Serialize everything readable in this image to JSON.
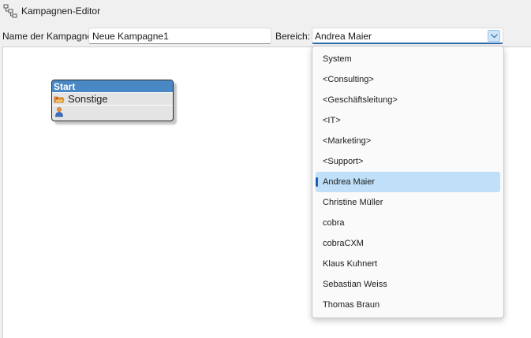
{
  "window": {
    "title": "Kampagnen-Editor",
    "icon": "campaign-flow-icon"
  },
  "form": {
    "name_label": "Name der Kampagne:",
    "name_value": "Neue Kampagne1",
    "area_label": "Bereich:",
    "area_value": "Andrea Maier"
  },
  "node": {
    "header": "Start",
    "rows": [
      {
        "icon": "folder-icon",
        "text": "Sonstige"
      },
      {
        "icon": "person-icon",
        "text": ""
      }
    ],
    "header_color": "#4a87c5"
  },
  "dropdown": {
    "selected_index": 6,
    "options": [
      "System",
      "<Consulting>",
      "<Geschäftsleitung>",
      "<IT>",
      "<Marketing>",
      "<Support>",
      "Andrea Maier",
      "Christine Müller",
      "cobra",
      "cobraCXM",
      "Klaus Kuhnert",
      "Sebastian Weiss",
      "Thomas Braun"
    ],
    "selected_color": "#bfe0f8",
    "accent_color": "#1a5fb4"
  }
}
